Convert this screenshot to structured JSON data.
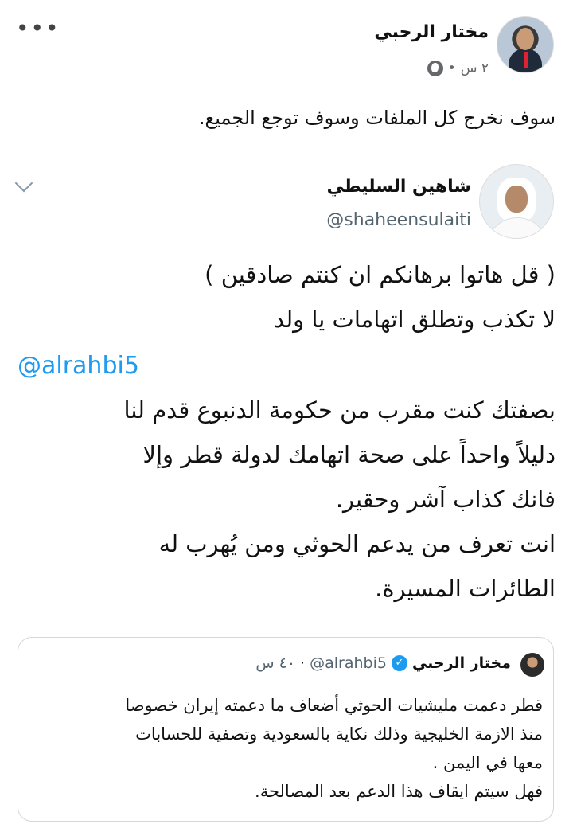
{
  "post": {
    "author_name": "مختار الرحبي",
    "time": "٢ س",
    "separator": "•",
    "privacy_icon": "globe-icon",
    "more_icon": "more-dots-icon",
    "text": "سوف نخرج كل الملفات وسوف توجع الجميع."
  },
  "tweet": {
    "author_name": "شاهين السليطي",
    "handle": "@shaheensulaiti",
    "menu_icon": "chevron-down-icon",
    "lines": [
      "( قل هاتوا برهانكم ان كنتم صادقين )",
      "لا تكذب وتطلق اتهامات يا ولد",
      "بصفتك كنت مقرب من حكومة الدنبوع قدم لنا",
      "دليلاً واحداً على صحة اتهامك لدولة قطر وإلا",
      "فانك كذاب آشر وحقير.",
      "انت تعرف من يدعم الحوثي ومن يُهرب له",
      "الطائرات المسيرة."
    ],
    "mention": "@alrahbi5"
  },
  "quoted": {
    "author_name": "مختار الرحبي",
    "handle": "@alrahbi5",
    "time": "٤٠ س",
    "separator": "·",
    "verified_icon": "verified-badge-icon",
    "lines": [
      "قطر دعمت مليشيات الحوثي أضعاف ما دعمته إيران خصوصا",
      "منذ الازمة الخليجية وذلك نكاية بالسعودية وتصفية للحسابات",
      "معها في اليمن .",
      "فهل سيتم ايقاف هذا الدعم بعد المصالحة."
    ]
  },
  "colors": {
    "link": "#1d9bf0",
    "muted": "#65676b",
    "border": "#cfd9de"
  }
}
